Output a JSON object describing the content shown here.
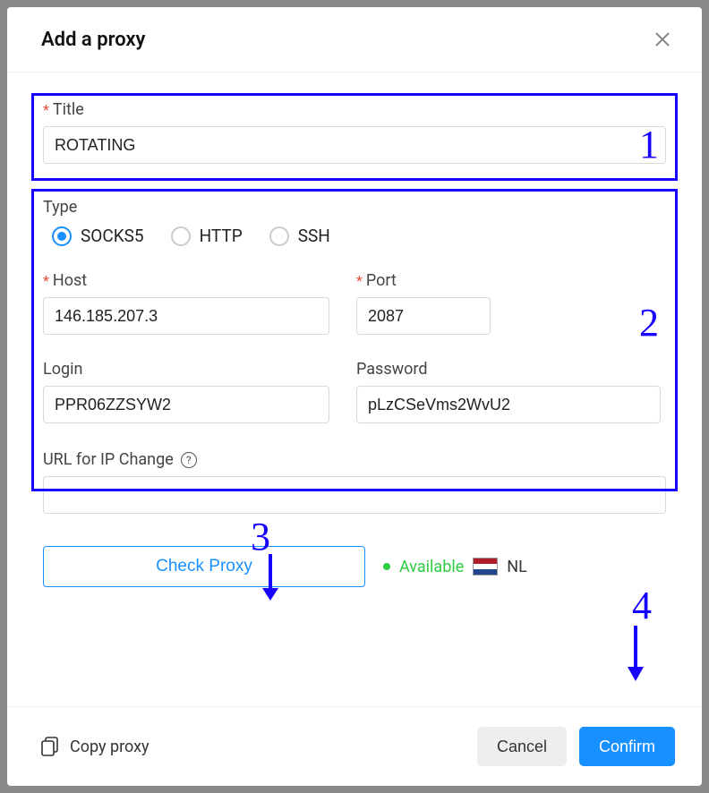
{
  "modal": {
    "title": "Add a proxy"
  },
  "fields": {
    "title_label": "Title",
    "title_value": "ROTATING",
    "type_label": "Type",
    "type_options": {
      "socks5": "SOCKS5",
      "http": "HTTP",
      "ssh": "SSH"
    },
    "host_label": "Host",
    "host_value": "146.185.207.3",
    "port_label": "Port",
    "port_value": "2087",
    "login_label": "Login",
    "login_value": "PPR06ZZSYW2",
    "password_label": "Password",
    "password_value": "pLzCSeVms2WvU2",
    "url_label": "URL for IP Change",
    "url_value": "",
    "check_proxy_label": "Check Proxy",
    "status_text": "Available",
    "country_code": "NL"
  },
  "footer": {
    "copy_proxy": "Copy proxy",
    "cancel": "Cancel",
    "confirm": "Confirm"
  },
  "annotations": {
    "n1": "1",
    "n2": "2",
    "n3": "3",
    "n4": "4"
  }
}
